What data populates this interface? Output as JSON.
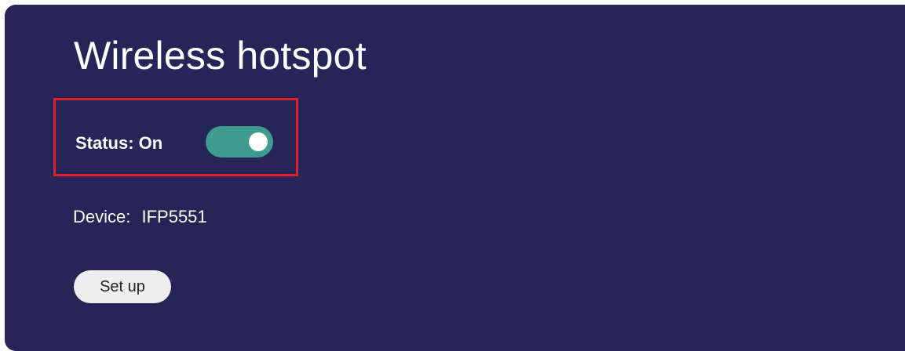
{
  "header": {
    "title": "Wireless hotspot"
  },
  "status": {
    "label": "Status: On",
    "toggle_on": true,
    "toggle_icon": "toggle-switch-on",
    "toggle_color": "#3e9b8d",
    "highlight_color": "#e0212b"
  },
  "device": {
    "label": "Device:",
    "value": "IFP5551"
  },
  "actions": {
    "setup_label": "Set up"
  },
  "colors": {
    "background": "#252558",
    "text": "#ffffff",
    "button_bg": "#eeeeee"
  }
}
